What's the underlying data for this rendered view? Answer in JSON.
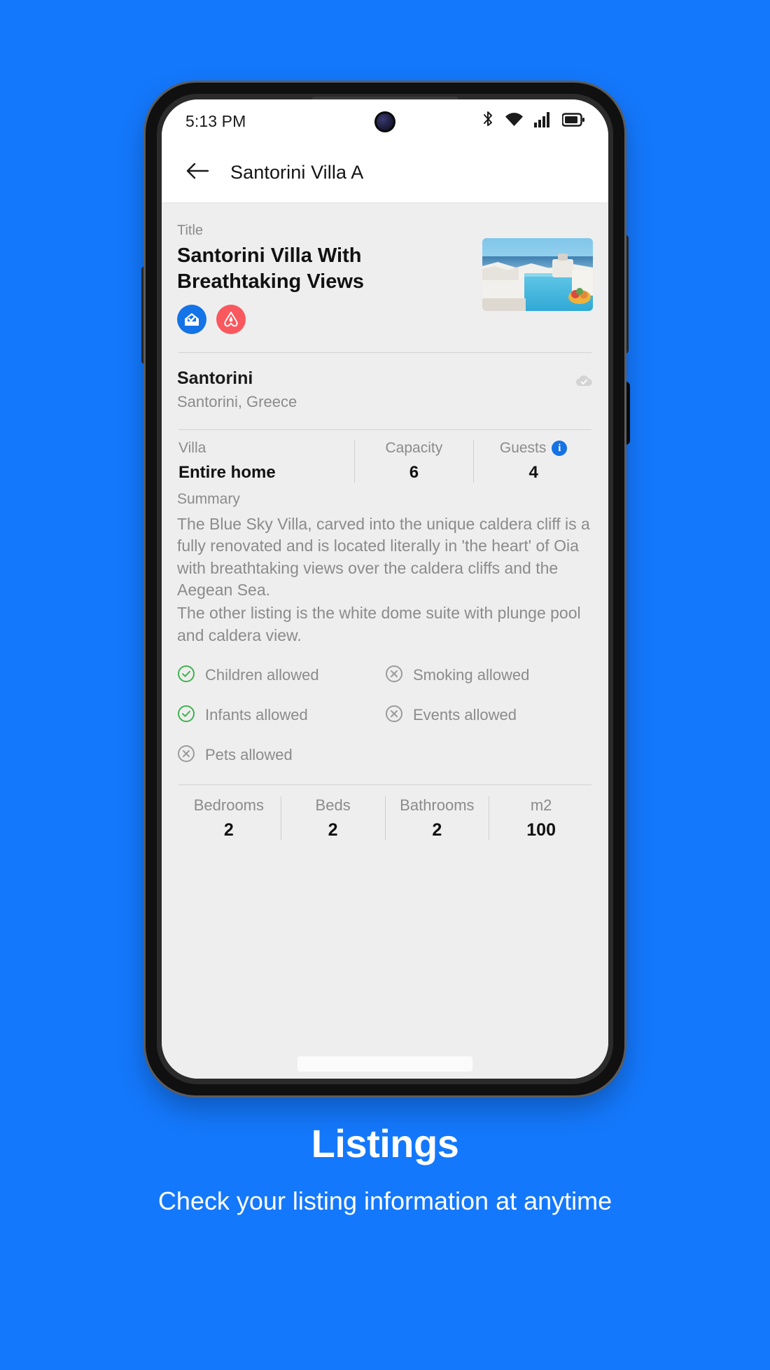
{
  "theme": {
    "brand_blue": "#1478fc",
    "screen_bg": "#efeeee",
    "green": "#3fb34f",
    "muted": "#8b8b8b"
  },
  "status_bar": {
    "time": "5:13 PM",
    "icons": [
      "bluetooth-icon",
      "wifi-icon",
      "cellular-signal-icon",
      "battery-icon"
    ]
  },
  "app_bar": {
    "back": "back-arrow-icon",
    "title": "Santorini Villa A"
  },
  "listing": {
    "title_label": "Title",
    "title": "Santorini Villa With Breathtaking Views",
    "channel_badges": [
      {
        "name": "booking-verified-badge",
        "color": "#1473e6"
      },
      {
        "name": "airbnb-badge",
        "color": "#f9585e"
      }
    ],
    "thumbnail_alt": "santorini-villa-pool-photo",
    "location": {
      "name": "Santorini",
      "address": "Santorini, Greece",
      "sync_icon": "cloud-sync-icon"
    },
    "stats": [
      {
        "label": "Villa",
        "value": "Entire home",
        "has_info": false
      },
      {
        "label": "Capacity",
        "value": "6",
        "has_info": false
      },
      {
        "label": "Guests",
        "value": "4",
        "has_info": true
      }
    ],
    "summary_label": "Summary",
    "summary_paragraphs": [
      "The Blue Sky Villa, carved into the unique caldera cliff is a fully renovated and is located literally in 'the heart' of Oia with breathtaking views over the caldera cliffs and the Aegean Sea.",
      "The other listing is the white dome suite with plunge pool and caldera view."
    ],
    "amenities": [
      [
        {
          "label": "Children allowed",
          "allowed": true
        },
        {
          "label": "Smoking allowed",
          "allowed": false
        }
      ],
      [
        {
          "label": "Infants allowed",
          "allowed": true
        },
        {
          "label": "Events allowed",
          "allowed": false
        }
      ],
      [
        {
          "label": "Pets allowed",
          "allowed": false
        }
      ]
    ],
    "room_stats": [
      {
        "label": "Bedrooms",
        "value": "2"
      },
      {
        "label": "Beds",
        "value": "2"
      },
      {
        "label": "Bathrooms",
        "value": "2"
      },
      {
        "label": "m2",
        "value": "100"
      }
    ]
  },
  "caption": {
    "title": "Listings",
    "subtitle": "Check your listing information at anytime"
  }
}
